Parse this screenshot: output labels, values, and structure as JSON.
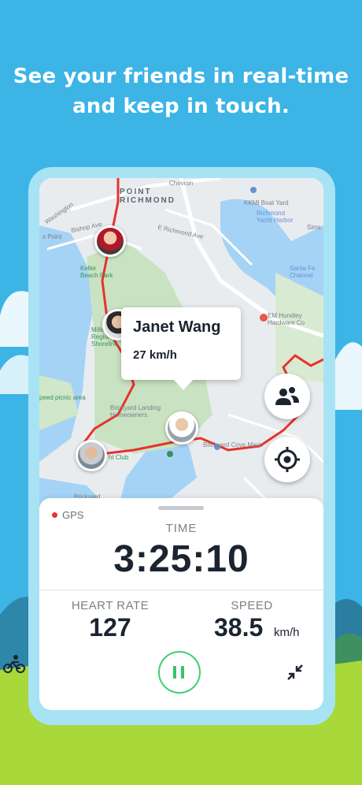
{
  "headline": {
    "line1": "See your friends in real-time",
    "line2": "and keep in touch."
  },
  "map": {
    "labels": {
      "point_richmond": "POINT\nRICHMOND",
      "chevron": "Chevron",
      "kkmi": "KKMI Boat Yard",
      "richmond_yacht": "Richmond\nYacht Harbor",
      "sims": "Sims",
      "santa_fe": "Santa Fe\nChannel",
      "em_hundley": "EM Hundley\nHardware Co",
      "s_point": "s Point",
      "keller_beach": "Keller\nBeach Park",
      "miller": "Miller/Kn\nRegiona\nShoreline",
      "brickyard_landing": "Brickyard Landing\nHomeowners",
      "brickyard_cove": "Brickyard Cove Marin",
      "picnic": "peed picnic area",
      "yacht_club": "ht Club",
      "washington": "Washington",
      "bishop": "Bishop Ave",
      "e_richmond": "E Richmond Ave",
      "brickyard_bottom": "Brickyard"
    },
    "popup": {
      "name": "Janet Wang",
      "speed": "27 km/h"
    },
    "route_color": "#e8322b",
    "icons": {
      "friends_button": "people-icon",
      "locate_button": "crosshair-icon"
    }
  },
  "stats": {
    "gps_label": "GPS",
    "time_label": "TIME",
    "time_value": "3:25:10",
    "heart_rate_label": "HEART RATE",
    "heart_rate_value": "127",
    "speed_label": "SPEED",
    "speed_value": "38.5",
    "speed_unit": "km/h"
  },
  "colors": {
    "sky": "#3cb4e6",
    "accent_green": "#3fcf73",
    "gps_dot": "#e8322b",
    "grass": "#a8d83a"
  }
}
